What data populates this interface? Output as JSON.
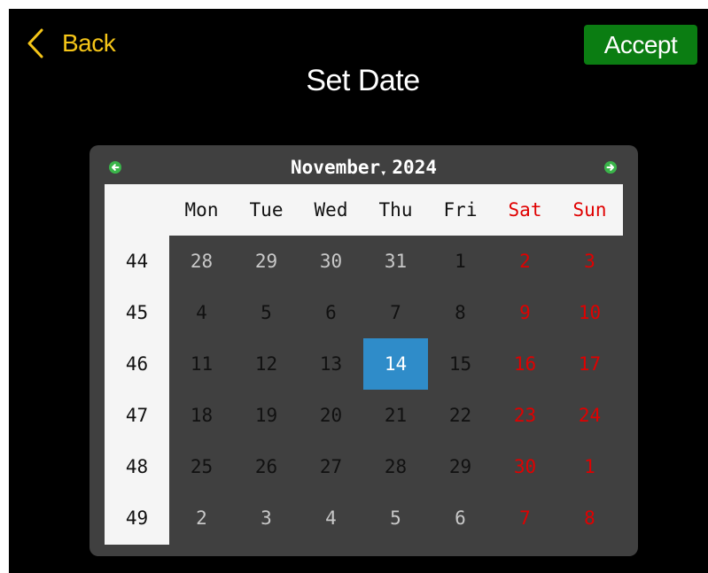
{
  "header": {
    "back_label": "Back",
    "accept_label": "Accept",
    "title": "Set Date"
  },
  "calendar": {
    "month": "November",
    "year": "2024",
    "weekdays": [
      {
        "label": "Mon",
        "weekend": false
      },
      {
        "label": "Tue",
        "weekend": false
      },
      {
        "label": "Wed",
        "weekend": false
      },
      {
        "label": "Thu",
        "weekend": false
      },
      {
        "label": "Fri",
        "weekend": false
      },
      {
        "label": "Sat",
        "weekend": true
      },
      {
        "label": "Sun",
        "weekend": true
      }
    ],
    "weeks": [
      {
        "number": "44",
        "days": [
          {
            "d": "28",
            "other": true
          },
          {
            "d": "29",
            "other": true
          },
          {
            "d": "30",
            "other": true
          },
          {
            "d": "31",
            "other": true
          },
          {
            "d": "1"
          },
          {
            "d": "2"
          },
          {
            "d": "3"
          }
        ]
      },
      {
        "number": "45",
        "days": [
          {
            "d": "4"
          },
          {
            "d": "5"
          },
          {
            "d": "6"
          },
          {
            "d": "7"
          },
          {
            "d": "8"
          },
          {
            "d": "9"
          },
          {
            "d": "10"
          }
        ]
      },
      {
        "number": "46",
        "days": [
          {
            "d": "11"
          },
          {
            "d": "12"
          },
          {
            "d": "13"
          },
          {
            "d": "14",
            "selected": true
          },
          {
            "d": "15"
          },
          {
            "d": "16"
          },
          {
            "d": "17"
          }
        ]
      },
      {
        "number": "47",
        "days": [
          {
            "d": "18"
          },
          {
            "d": "19"
          },
          {
            "d": "20"
          },
          {
            "d": "21"
          },
          {
            "d": "22"
          },
          {
            "d": "23"
          },
          {
            "d": "24"
          }
        ]
      },
      {
        "number": "48",
        "days": [
          {
            "d": "25"
          },
          {
            "d": "26"
          },
          {
            "d": "27"
          },
          {
            "d": "28"
          },
          {
            "d": "29"
          },
          {
            "d": "30"
          },
          {
            "d": "1",
            "other": true
          }
        ]
      },
      {
        "number": "49",
        "days": [
          {
            "d": "2",
            "other": true
          },
          {
            "d": "3",
            "other": true
          },
          {
            "d": "4",
            "other": true
          },
          {
            "d": "5",
            "other": true
          },
          {
            "d": "6",
            "other": true
          },
          {
            "d": "7",
            "other": true
          },
          {
            "d": "8",
            "other": true
          }
        ]
      }
    ]
  },
  "icons": {
    "back": "chevron-left-icon",
    "prev": "arrow-left-icon",
    "next": "arrow-right-icon"
  },
  "colors": {
    "background": "#000000",
    "accent": "#f5c518",
    "accept": "#0b7d12",
    "calendar_bg": "#404040",
    "selected": "#2f8cc9",
    "weekend": "#e00000",
    "nav_arrow": "#3ab54a"
  }
}
